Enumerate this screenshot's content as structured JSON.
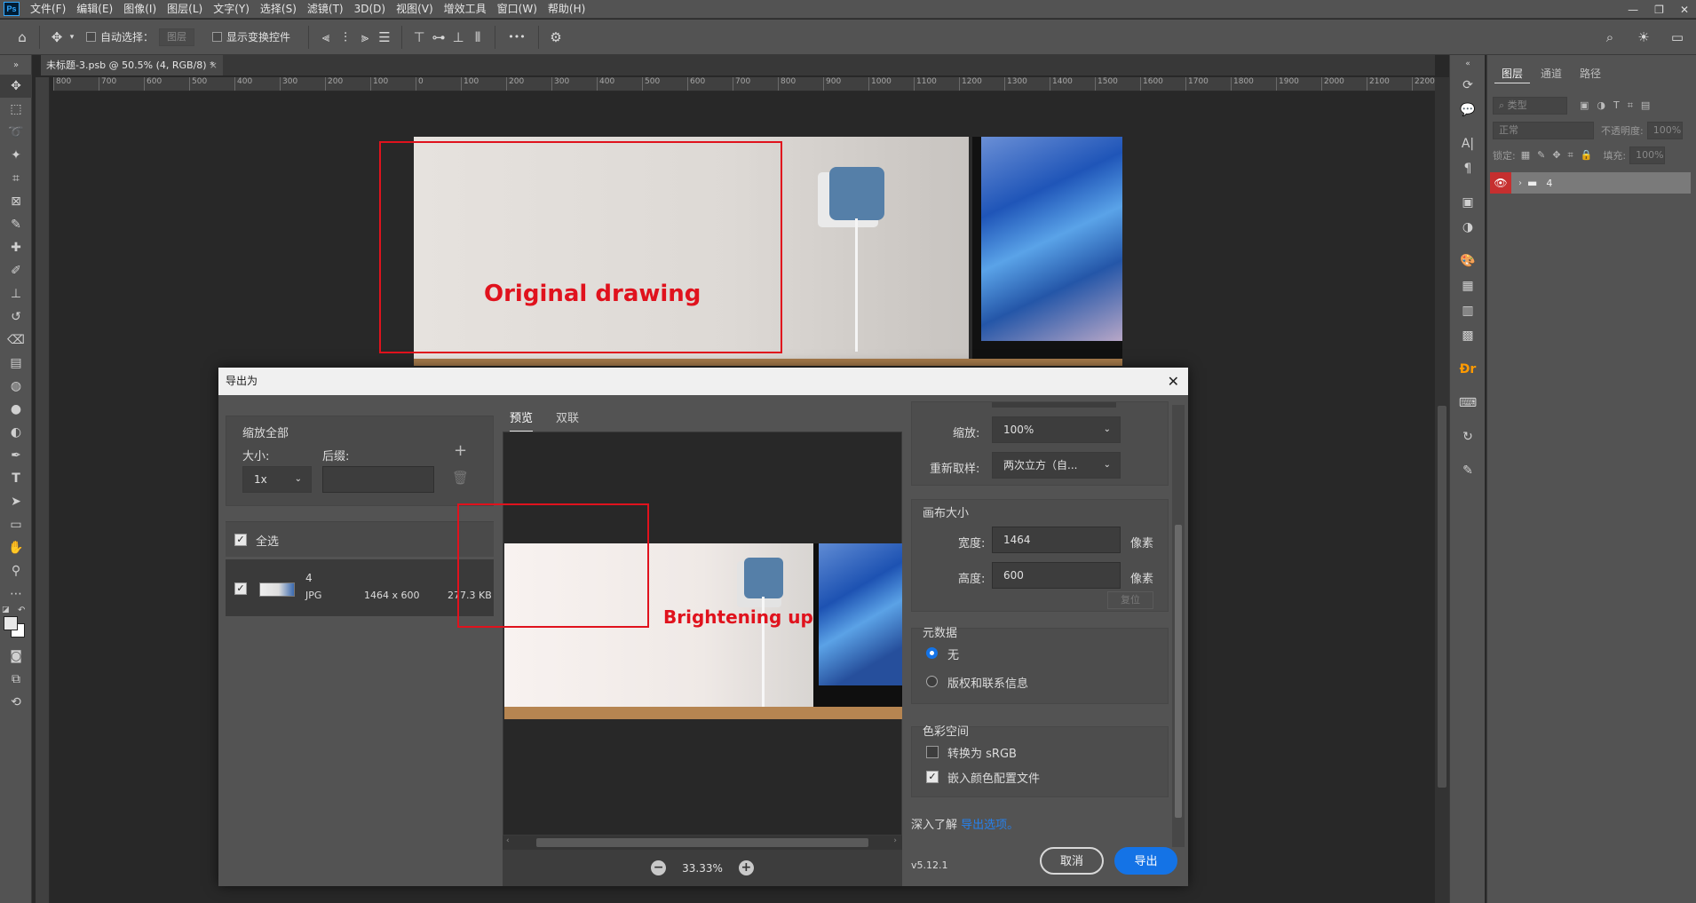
{
  "menubar": {
    "logo": "Ps",
    "items": [
      "文件(F)",
      "编辑(E)",
      "图像(I)",
      "图层(L)",
      "文字(Y)",
      "选择(S)",
      "滤镜(T)",
      "3D(D)",
      "视图(V)",
      "增效工具",
      "窗口(W)",
      "帮助(H)"
    ],
    "window_controls": [
      "—",
      "❐",
      "✕"
    ]
  },
  "options_bar": {
    "auto_select_label": "自动选择：",
    "layer_field": "图层",
    "show_transform_label": "显示变换控件",
    "more_label": "•••"
  },
  "document_tab": {
    "title": "未标题-3.psb @ 50.5% (4, RGB/8) *",
    "close": "×"
  },
  "ruler": {
    "ticks": [
      "800",
      "700",
      "600",
      "500",
      "400",
      "300",
      "200",
      "100",
      "0",
      "100",
      "200",
      "300",
      "400",
      "500",
      "600",
      "700",
      "800",
      "900",
      "1000",
      "1100",
      "1200",
      "1300",
      "1400",
      "1500",
      "1600",
      "1700",
      "1800",
      "1900",
      "2000",
      "2100",
      "2200"
    ]
  },
  "canvas": {
    "annotation_label": "Original drawing",
    "annotation_color": "#e0121d"
  },
  "dialog": {
    "title": "导出为",
    "close": "✕",
    "left": {
      "scale_all_title": "缩放全部",
      "size_label": "大小:",
      "suffix_label": "后缀:",
      "add_icon": "+",
      "size_value": "1x",
      "suffix_value": "",
      "select_all_label": "全选",
      "asset": {
        "name": "4",
        "format": "JPG",
        "dimensions": "1464 x 600",
        "filesize": "277.3 KB"
      }
    },
    "preview": {
      "tabs": [
        "预览",
        "双联"
      ],
      "annotation_label": "Brightening up",
      "zoom_minus": "−",
      "zoom_plus": "+",
      "zoom_value": "33.33%"
    },
    "settings": {
      "scale_label": "缩放:",
      "scale_value": "100%",
      "resample_label": "重新取样:",
      "resample_value": "两次立方（自...",
      "canvas_size_title": "画布大小",
      "width_label": "宽度:",
      "width_value": "1464",
      "height_label": "高度:",
      "height_value": "600",
      "unit": "像素",
      "reset_label": "复位",
      "metadata_title": "元数据",
      "metadata_none": "无",
      "metadata_copyright": "版权和联系信息",
      "colorspace_title": "色彩空间",
      "convert_srgb": "转换为 sRGB",
      "embed_profile": "嵌入颜色配置文件",
      "convert_srgb_checked": false,
      "embed_profile_checked": true
    },
    "learn_prefix": "深入了解",
    "learn_link": "导出选项。",
    "version": "v5.12.1",
    "cancel_label": "取消",
    "export_label": "导出",
    "accent_color": "#1473e6"
  },
  "layers_panel": {
    "tabs": [
      "图层",
      "通道",
      "路径"
    ],
    "search_placeholder": "类型",
    "blend_mode": "正常",
    "opacity_label": "不透明度:",
    "opacity_value": "100%",
    "lock_label": "锁定:",
    "fill_label": "填充:",
    "fill_value": "100%",
    "layer_name": "4"
  }
}
